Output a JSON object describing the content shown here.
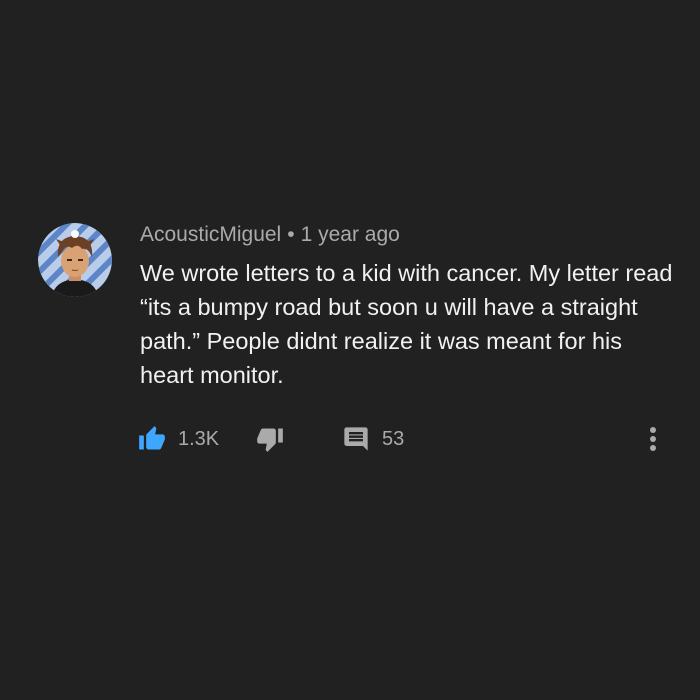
{
  "comment": {
    "author": "AcousticMiguel",
    "separator": "•",
    "timestamp": "1 year ago",
    "text": "We wrote letters to a kid with cancer. My letter read “its a bumpy road but soon u will have a straight path.” People didnt realize it was meant for his heart monitor.",
    "like_count": "1.3K",
    "reply_count": "53"
  },
  "icons": {
    "like": "thumbs-up-icon",
    "dislike": "thumbs-down-icon",
    "reply": "comment-icon",
    "more": "more-vertical-icon"
  },
  "colors": {
    "background": "#212121",
    "text_primary": "#f1f1f1",
    "text_secondary": "#aaaaaa",
    "like_active": "#3ea6ff"
  }
}
